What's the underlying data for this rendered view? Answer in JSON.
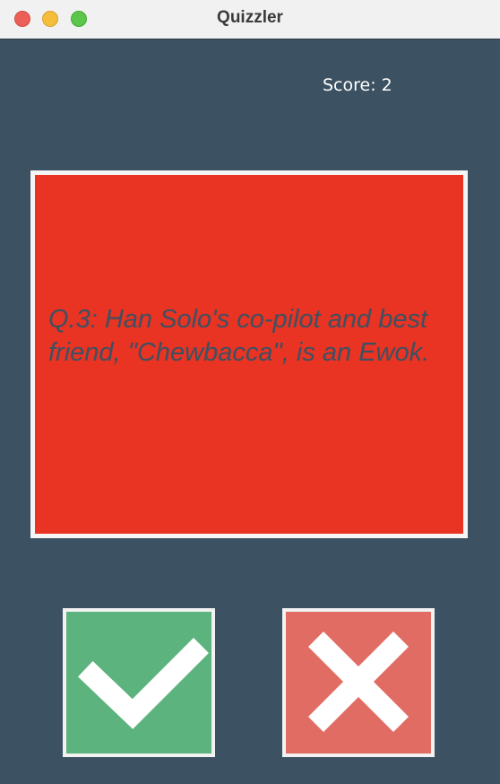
{
  "window": {
    "title": "Quizzler"
  },
  "score": {
    "text": "Score: 2"
  },
  "question": {
    "text": "Q.3: Han Solo's co-pilot and best friend, \"Chewbacca\", is an Ewok."
  },
  "buttons": {
    "true_icon": "checkmark-icon",
    "false_icon": "cross-icon"
  },
  "colors": {
    "background": "#3c5161",
    "card": "#e93323",
    "true_button": "#5db37e",
    "false_button": "#e06c63"
  }
}
